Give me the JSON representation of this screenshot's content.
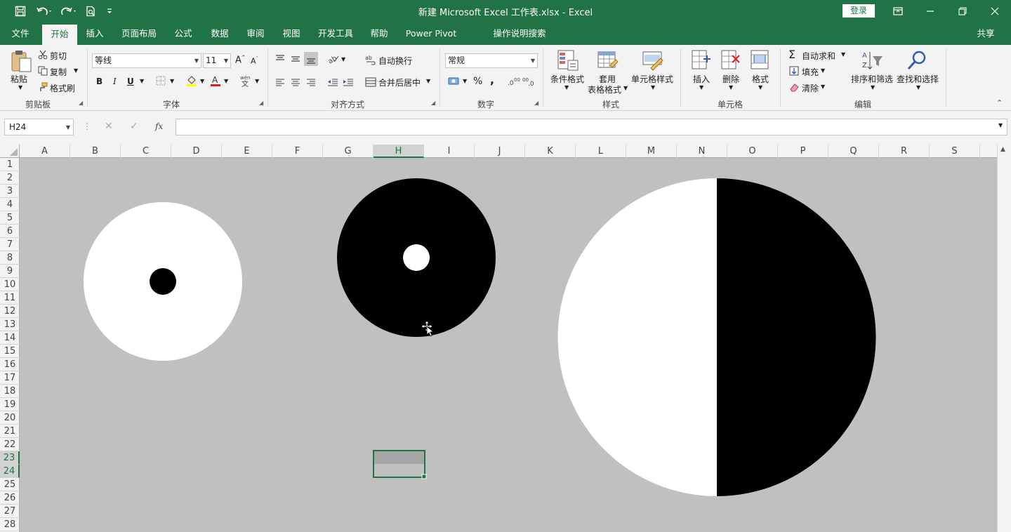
{
  "titlebar": {
    "title": "新建 Microsoft Excel 工作表.xlsx  -  Excel",
    "login": "登录"
  },
  "tabs": [
    {
      "label": "文件"
    },
    {
      "label": "开始"
    },
    {
      "label": "插入"
    },
    {
      "label": "页面布局"
    },
    {
      "label": "公式"
    },
    {
      "label": "数据"
    },
    {
      "label": "审阅"
    },
    {
      "label": "视图"
    },
    {
      "label": "开发工具"
    },
    {
      "label": "帮助"
    },
    {
      "label": "Power Pivot"
    },
    {
      "label": "操作说明搜索"
    }
  ],
  "share": "共享",
  "ribbon": {
    "clipboard": {
      "paste": "粘贴",
      "cut": "剪切",
      "copy": "复制",
      "format_painter": "格式刷",
      "label": "剪贴板"
    },
    "font": {
      "name": "等线",
      "size": "11",
      "bold": "B",
      "italic": "I",
      "underline": "U",
      "label": "字体"
    },
    "alignment": {
      "wrap": "自动换行",
      "merge": "合并后居中",
      "label": "对齐方式"
    },
    "number": {
      "format": "常规",
      "percent": "%",
      "comma": ",",
      "label": "数字"
    },
    "styles": {
      "conditional": "条件格式",
      "table_line1": "套用",
      "table_line2": "表格格式",
      "cell_styles": "单元格样式",
      "label": "样式"
    },
    "cells": {
      "insert": "插入",
      "delete": "删除",
      "format": "格式",
      "label": "单元格"
    },
    "editing": {
      "autosum": "自动求和",
      "fill": "填充",
      "clear": "清除",
      "sort": "排序和筛选",
      "find": "查找和选择",
      "label": "编辑"
    }
  },
  "formula_bar": {
    "name_box": "H24",
    "fx": "fx",
    "value": ""
  },
  "columns": [
    "A",
    "B",
    "C",
    "D",
    "E",
    "F",
    "G",
    "H",
    "I",
    "J",
    "K",
    "L",
    "M",
    "N",
    "O",
    "P",
    "Q",
    "R",
    "S"
  ],
  "rows": [
    "1",
    "2",
    "3",
    "4",
    "5",
    "6",
    "7",
    "8",
    "9",
    "10",
    "11",
    "12",
    "13",
    "14",
    "15",
    "16",
    "17",
    "18",
    "19",
    "20",
    "21",
    "22",
    "23",
    "24",
    "25",
    "26",
    "27",
    "28"
  ],
  "selected": {
    "column": "H",
    "rows": [
      "23",
      "24"
    ]
  },
  "colors": {
    "brand": "#217346",
    "sheet_bg": "#c0c0c0",
    "black": "#000000",
    "white": "#ffffff"
  }
}
